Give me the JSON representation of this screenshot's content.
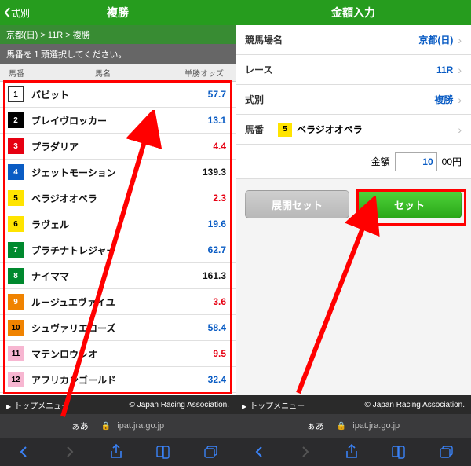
{
  "left": {
    "back_label": "式別",
    "title": "複勝",
    "breadcrumb": "京都(日) > 11R > 複勝",
    "instruction": "馬番を１頭選択してください。",
    "head": {
      "num": "馬番",
      "name": "馬名",
      "odds": "単勝オッズ"
    },
    "rows": [
      {
        "n": "1",
        "bg": "#ffffff",
        "fg": "#000000",
        "name": "バビット",
        "odds": "57.7",
        "oc": "#0a5cc4"
      },
      {
        "n": "2",
        "bg": "#000000",
        "fg": "#ffffff",
        "name": "ブレイヴロッカー",
        "odds": "13.1",
        "oc": "#0a5cc4"
      },
      {
        "n": "3",
        "bg": "#e60012",
        "fg": "#ffffff",
        "name": "プラダリア",
        "odds": "4.4",
        "oc": "#e60012"
      },
      {
        "n": "4",
        "bg": "#0a5cc4",
        "fg": "#ffffff",
        "name": "ジェットモーション",
        "odds": "139.3",
        "oc": "#111111"
      },
      {
        "n": "5",
        "bg": "#ffe400",
        "fg": "#000000",
        "name": "ベラジオオペラ",
        "odds": "2.3",
        "oc": "#e60012"
      },
      {
        "n": "6",
        "bg": "#ffe400",
        "fg": "#000000",
        "name": "ラヴェル",
        "odds": "19.6",
        "oc": "#0a5cc4"
      },
      {
        "n": "7",
        "bg": "#00892e",
        "fg": "#ffffff",
        "name": "プラチナトレジャー",
        "odds": "62.7",
        "oc": "#0a5cc4"
      },
      {
        "n": "8",
        "bg": "#00892e",
        "fg": "#ffffff",
        "name": "ナイママ",
        "odds": "161.3",
        "oc": "#111111"
      },
      {
        "n": "9",
        "bg": "#f08300",
        "fg": "#ffffff",
        "name": "ルージュエヴァイユ",
        "odds": "3.6",
        "oc": "#e60012"
      },
      {
        "n": "10",
        "bg": "#f08300",
        "fg": "#000000",
        "name": "シュヴァリエローズ",
        "odds": "58.4",
        "oc": "#0a5cc4"
      },
      {
        "n": "11",
        "bg": "#f7b6d1",
        "fg": "#000000",
        "name": "マテンロウレオ",
        "odds": "9.5",
        "oc": "#e60012"
      },
      {
        "n": "12",
        "bg": "#f7b6d1",
        "fg": "#000000",
        "name": "アフリカンゴールド",
        "odds": "32.4",
        "oc": "#0a5cc4"
      }
    ],
    "footer_menu": "トップメニュー",
    "copyright": "© Japan Racing Association.",
    "url": "ipat.jra.go.jp",
    "aa": "ぁあ"
  },
  "right": {
    "title": "金額入力",
    "rows": [
      {
        "k": "競馬場名",
        "v": "京都(日)"
      },
      {
        "k": "レース",
        "v": "11R"
      },
      {
        "k": "式別",
        "v": "複勝"
      }
    ],
    "horse_label": "馬番",
    "horse_num": "5",
    "horse_num_bg": "#ffe400",
    "horse_num_fg": "#000000",
    "horse_name": "ベラジオオペラ",
    "amount_label": "金額",
    "amount_value": "10",
    "amount_suffix": "00円",
    "btn_expand": "展開セット",
    "btn_set": "セット",
    "footer_menu": "トップメニュー",
    "copyright": "© Japan Racing Association.",
    "url": "ipat.jra.go.jp",
    "aa": "ぁあ"
  }
}
